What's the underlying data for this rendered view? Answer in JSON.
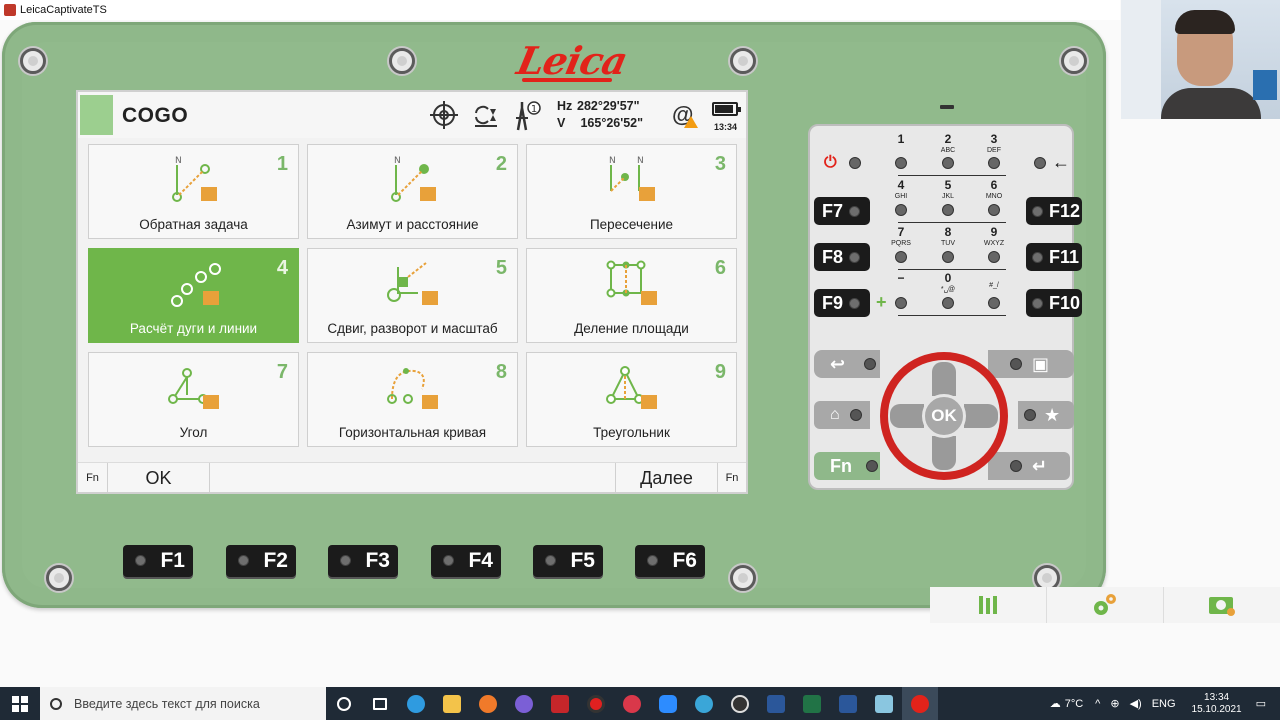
{
  "window": {
    "title": "LeicaCaptivateTS"
  },
  "device": {
    "logo": "Leica",
    "screen": {
      "title": "COGO",
      "status": {
        "hz_label": "Hz",
        "hz_value": "282°29'57\"",
        "v_label": "V",
        "v_value": "165°26'52\"",
        "time": "13:34",
        "prism_number": "1"
      },
      "tiles": [
        {
          "num": "1",
          "label": "Обратная задача"
        },
        {
          "num": "2",
          "label": "Азимут и расстояние"
        },
        {
          "num": "3",
          "label": "Пересечение"
        },
        {
          "num": "4",
          "label": "Расчёт дуги и линии"
        },
        {
          "num": "5",
          "label": "Сдвиг, разворот и масштаб"
        },
        {
          "num": "6",
          "label": "Деление площади"
        },
        {
          "num": "7",
          "label": "Угол"
        },
        {
          "num": "8",
          "label": "Горизонтальная кривая"
        },
        {
          "num": "9",
          "label": "Треугольник"
        }
      ],
      "footer": {
        "fn_left": "Fn",
        "ok": "OK",
        "next": "Далее",
        "fn_right": "Fn"
      }
    },
    "function_keys": [
      "F1",
      "F2",
      "F3",
      "F4",
      "F5",
      "F6"
    ],
    "keypad": {
      "side_left": [
        "F7",
        "F8",
        "F9"
      ],
      "side_right": [
        "F12",
        "F11",
        "F10"
      ],
      "digits": [
        {
          "d": "1",
          "sub": ""
        },
        {
          "d": "2",
          "sub": "ABC"
        },
        {
          "d": "3",
          "sub": "DEF"
        },
        {
          "d": "4",
          "sub": "GHI"
        },
        {
          "d": "5",
          "sub": "JKL"
        },
        {
          "d": "6",
          "sub": "MNO"
        },
        {
          "d": "7",
          "sub": "PQRS"
        },
        {
          "d": "8",
          "sub": "TUV"
        },
        {
          "d": "9",
          "sub": "WXYZ"
        },
        {
          "d": "−",
          "sub": ""
        },
        {
          "d": "0",
          "sub": "*␣@"
        },
        {
          "d": "",
          "sub": "#_/"
        }
      ],
      "ok": "OK",
      "fn": "Fn"
    }
  },
  "taskbar": {
    "search_placeholder": "Введите здесь текст для поиска",
    "weather": "7°C",
    "lang": "ENG",
    "time": "13:34",
    "date": "15.10.2021"
  },
  "colors": {
    "accent_green": "#6fb64a",
    "leica_red": "#e2231a",
    "device_body": "#8fb88a"
  }
}
